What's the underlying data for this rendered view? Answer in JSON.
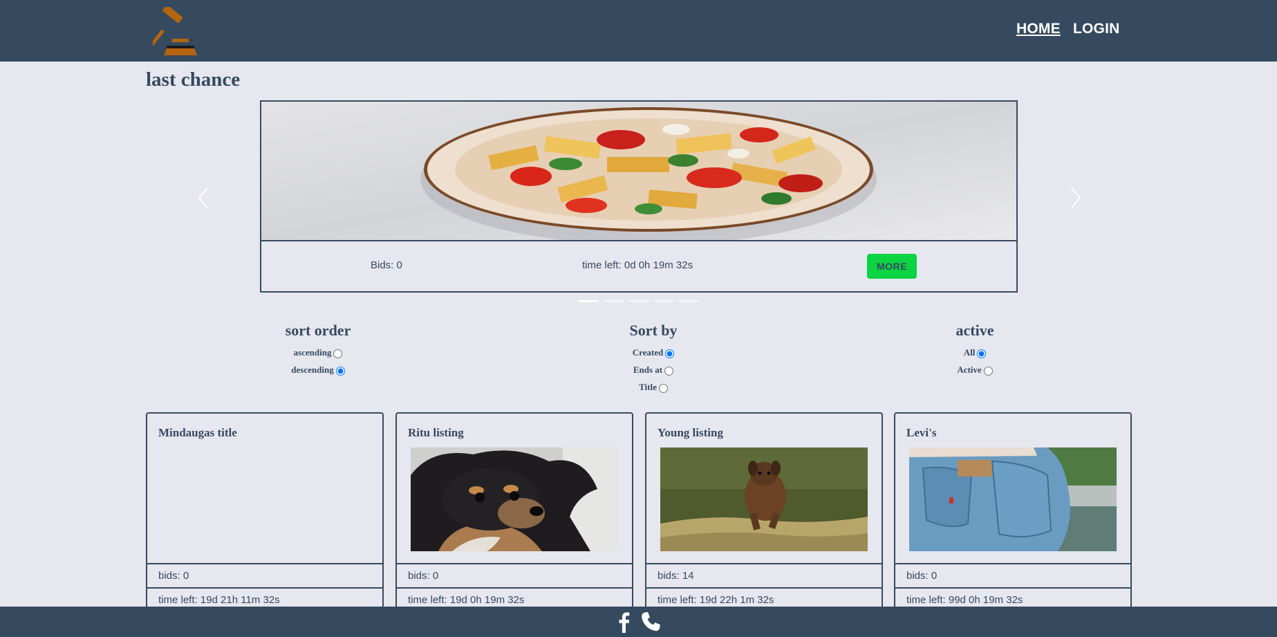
{
  "header": {
    "logo": "gavel-logo",
    "nav": {
      "home": "HOME",
      "login": "LOGIN"
    }
  },
  "section": {
    "title": "last chance"
  },
  "carousel": {
    "image": "pasta-plate",
    "bids_text": "Bids: 0",
    "time_text": "time left: 0d 0h 19m 32s",
    "more_label": "MORE",
    "slide_count": 5,
    "active_slide": 1
  },
  "filters": {
    "sort_order": {
      "title": "sort order",
      "options": [
        {
          "label": "ascending",
          "checked": false
        },
        {
          "label": "descending",
          "checked": true
        }
      ]
    },
    "sort_by": {
      "title": "Sort by",
      "options": [
        {
          "label": "Created",
          "checked": true
        },
        {
          "label": "Ends at",
          "checked": false
        },
        {
          "label": "Title",
          "checked": false
        }
      ]
    },
    "active": {
      "title": "active",
      "options": [
        {
          "label": "All",
          "checked": true
        },
        {
          "label": "Active",
          "checked": false
        }
      ]
    }
  },
  "listings": [
    {
      "title": "Mindaugas title",
      "image": "",
      "bids": "bids: 0",
      "time": "time left: 19d 21h 11m 32s"
    },
    {
      "title": "Ritu listing",
      "image": "chihuahua-dog",
      "bids": "bids: 0",
      "time": "time left: 19d 0h 19m 32s"
    },
    {
      "title": "Young listing",
      "image": "running-terrier-dog",
      "bids": "bids: 14",
      "time": "time left: 19d 22h 1m 32s"
    },
    {
      "title": "Levi's",
      "image": "levis-jeans",
      "bids": "bids: 0",
      "time": "time left: 99d 0h 19m 32s"
    }
  ],
  "footer": {
    "icons": [
      "facebook-icon",
      "phone-icon"
    ]
  },
  "colors": {
    "navy": "#364a5f",
    "background": "#e6e7ef",
    "accent_green": "#0bd342",
    "logo_brown": "#b5650d"
  }
}
